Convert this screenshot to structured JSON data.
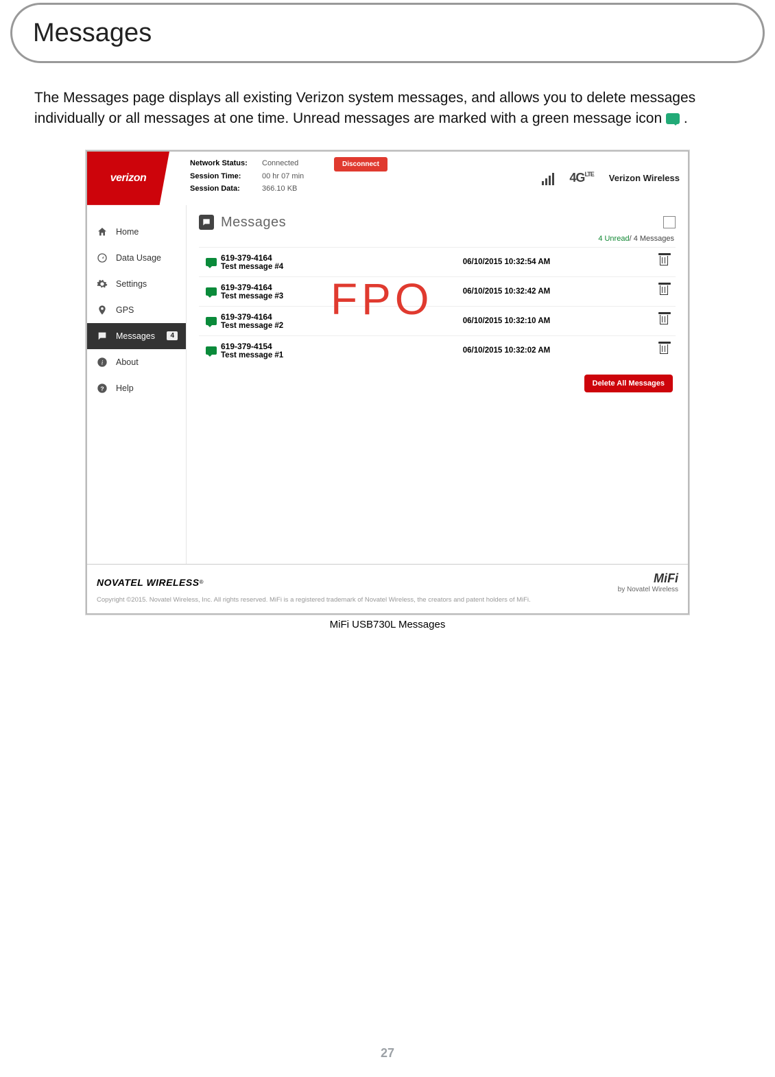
{
  "page": {
    "title": "Messages",
    "intro_a": "The Messages page displays all existing Verizon system messages, and allows you to delete messages individually or all messages at one time. Unread messages are marked with a green message icon ",
    "intro_b": " .",
    "caption": "MiFi USB730L Messages",
    "number": "27"
  },
  "watermark": "FPO",
  "header": {
    "logo_text": "verizon",
    "stats": {
      "network_status_k": "Network Status:",
      "network_status_v": "Connected",
      "session_time_k": "Session Time:",
      "session_time_v": "00 hr 07 min",
      "session_data_k": "Session Data:",
      "session_data_v": "366.10 KB"
    },
    "disconnect": "Disconnect",
    "lte": "4G",
    "lte_sup": "LTE",
    "carrier": "Verizon Wireless"
  },
  "sidebar": [
    {
      "label": "Home",
      "active": false,
      "badge": ""
    },
    {
      "label": "Data Usage",
      "active": false,
      "badge": ""
    },
    {
      "label": "Settings",
      "active": false,
      "badge": ""
    },
    {
      "label": "GPS",
      "active": false,
      "badge": ""
    },
    {
      "label": "Messages",
      "active": true,
      "badge": "4"
    },
    {
      "label": "About",
      "active": false,
      "badge": ""
    },
    {
      "label": "Help",
      "active": false,
      "badge": ""
    }
  ],
  "panel": {
    "title": "Messages",
    "unread": "4 Unread",
    "total": "/ 4 Messages",
    "delete_all": "Delete All Messages"
  },
  "messages": [
    {
      "number": "619-379-4164",
      "subject": "Test message #4",
      "date": "06/10/2015 10:32:54 AM"
    },
    {
      "number": "619-379-4164",
      "subject": "Test message #3",
      "date": "06/10/2015 10:32:42 AM"
    },
    {
      "number": "619-379-4164",
      "subject": "Test message #2",
      "date": "06/10/2015 10:32:10 AM"
    },
    {
      "number": "619-379-4154",
      "subject": "Test message #1",
      "date": "06/10/2015 10:32:02 AM"
    }
  ],
  "footer": {
    "brand": "NOVATEL WIRELESS",
    "mifi_logo": "MiFi",
    "mifi_tag": "by Novatel Wireless",
    "copyright": "Copyright ©2015. Novatel Wireless, Inc. All rights reserved. MiFi is a registered trademark of Novatel Wireless, the creators and patent holders of MiFi."
  }
}
